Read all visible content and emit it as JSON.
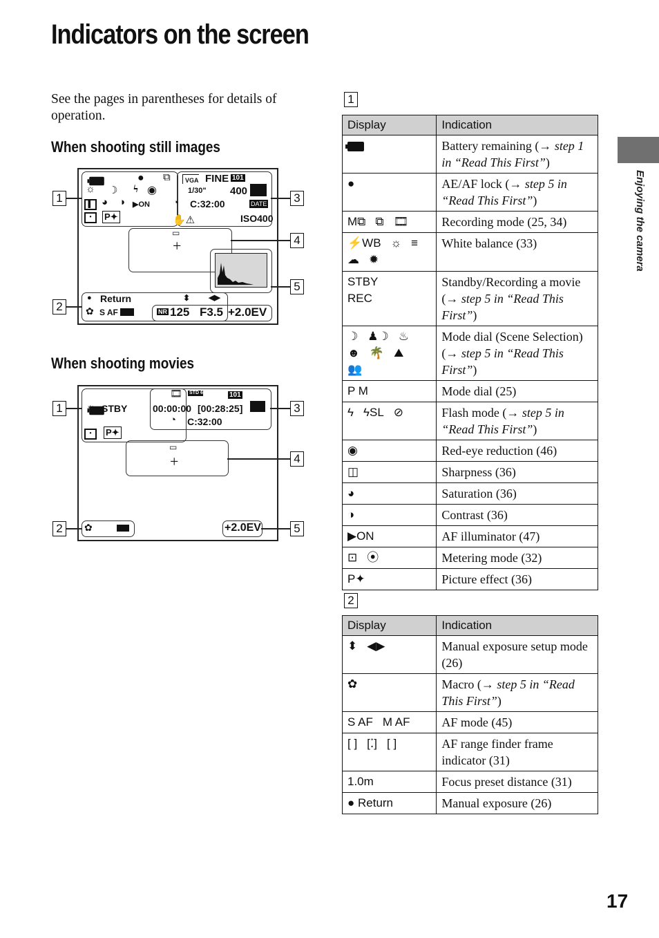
{
  "page": {
    "title": "Indicators on the screen",
    "intro": "See the pages in parentheses for details of operation.",
    "section_still": "When shooting still images",
    "section_movie": "When shooting movies",
    "side_tab_label": "Enjoying the camera",
    "page_number": "17"
  },
  "callouts": [
    "1",
    "2",
    "3",
    "4",
    "5"
  ],
  "still_screen": {
    "g1_icons": [
      "battery-icon",
      "ae-af-lock-dot",
      "burst-mode-icon",
      "wb-incandescent-icon",
      "twilight-icon",
      "flash-icon",
      "red-eye-icon",
      "sharpness-icon",
      "saturation-icon",
      "contrast-icon",
      "af-illuminator-icon",
      "spot-metering-icon",
      "picture-effect-icon"
    ],
    "af_on_label": "ON",
    "vga_label": "VGA",
    "fine_label": "FINE",
    "folder_label": "101",
    "shutter_label": "1/30\"",
    "remaining_label": "400",
    "battery_time_label": "C:32:00",
    "date_label": "DATE",
    "iso_label": "ISO400",
    "return_label": "Return",
    "updown_label": "⬍",
    "leftright_label": "◀▶",
    "af_mode_label": "S AF",
    "nr_label": "NR",
    "shutter_speed": "125",
    "aperture": "F3.5",
    "ev_value": "+2.0EV"
  },
  "movie_screen": {
    "stby_label": "STBY",
    "std_label": "STD 640",
    "folder_label": "101",
    "time_label": "00:00:00",
    "remaining_time_label": "[00:28:25]",
    "battery_time_label": "C:32:00",
    "ev_value": "+2.0EV"
  },
  "table1": {
    "number": "1",
    "header": {
      "display": "Display",
      "indication": "Indication"
    },
    "rows": [
      {
        "display": [
          "battery-icon"
        ],
        "text": "Battery remaining (→ ",
        "italic": "step 1 in “Read This First”",
        "after": ")"
      },
      {
        "display": [
          "●"
        ],
        "text": "AE/AF lock (→ ",
        "italic": "step 5 in “Read This First”",
        "after": ")"
      },
      {
        "display": [
          "M⧉",
          "⧉",
          "🎞"
        ],
        "text": "Recording mode (25, 34)",
        "italic": "",
        "after": ""
      },
      {
        "display": [
          "⚡WB",
          "☼",
          "≡",
          "☁",
          "✹"
        ],
        "text": "White balance (33)",
        "italic": "",
        "after": ""
      },
      {
        "display": [
          "STBY",
          "REC"
        ],
        "text": "Standby/Recording a movie (→ ",
        "italic": "step 5 in “Read This First”",
        "after": ")"
      },
      {
        "display": [
          "☽",
          "♟☽",
          "♨",
          "☻",
          "🌴",
          "⛰",
          "👥"
        ],
        "text": "Mode dial (Scene Selection) (→ ",
        "italic": "step 5 in “Read This First”",
        "after": ")"
      },
      {
        "display": [
          "P M"
        ],
        "text": "Mode dial (25)",
        "italic": "",
        "after": ""
      },
      {
        "display": [
          "ϟ",
          "ϟSL",
          "⊘"
        ],
        "text": "Flash mode (→ ",
        "italic": "step 5 in “Read This First”",
        "after": ")"
      },
      {
        "display": [
          "◉"
        ],
        "text": "Red-eye reduction (46)",
        "italic": "",
        "after": ""
      },
      {
        "display": [
          "◫"
        ],
        "text": "Sharpness (36)",
        "italic": "",
        "after": ""
      },
      {
        "display": [
          "◕"
        ],
        "text": "Saturation (36)",
        "italic": "",
        "after": ""
      },
      {
        "display": [
          "◑"
        ],
        "text": "Contrast (36)",
        "italic": "",
        "after": ""
      },
      {
        "display": [
          "▶ON"
        ],
        "text": "AF illuminator (47)",
        "italic": "",
        "after": ""
      },
      {
        "display": [
          "⊡",
          "⦿"
        ],
        "text": "Metering mode (32)",
        "italic": "",
        "after": ""
      },
      {
        "display": [
          "P✦"
        ],
        "text": "Picture effect (36)",
        "italic": "",
        "after": ""
      }
    ]
  },
  "table2": {
    "number": "2",
    "header": {
      "display": "Display",
      "indication": "Indication"
    },
    "rows": [
      {
        "display": [
          "⬍",
          "◀▶"
        ],
        "text": "Manual exposure setup mode (26)",
        "italic": "",
        "after": ""
      },
      {
        "display": [
          "✿"
        ],
        "text": "Macro (→ ",
        "italic": "step 5 in “Read This First”",
        "after": ")"
      },
      {
        "display": [
          "S AF",
          "M AF"
        ],
        "text": "AF mode (45)",
        "italic": "",
        "after": ""
      },
      {
        "display": [
          "[ ]",
          "[⁚]",
          "[  ]"
        ],
        "text": "AF range finder frame indicator (31)",
        "italic": "",
        "after": ""
      },
      {
        "display": [
          "1.0m"
        ],
        "text": "Focus preset distance (31)",
        "italic": "",
        "after": ""
      },
      {
        "display": [
          "● Return"
        ],
        "text": "Manual exposure (26)",
        "italic": "",
        "after": ""
      }
    ]
  }
}
